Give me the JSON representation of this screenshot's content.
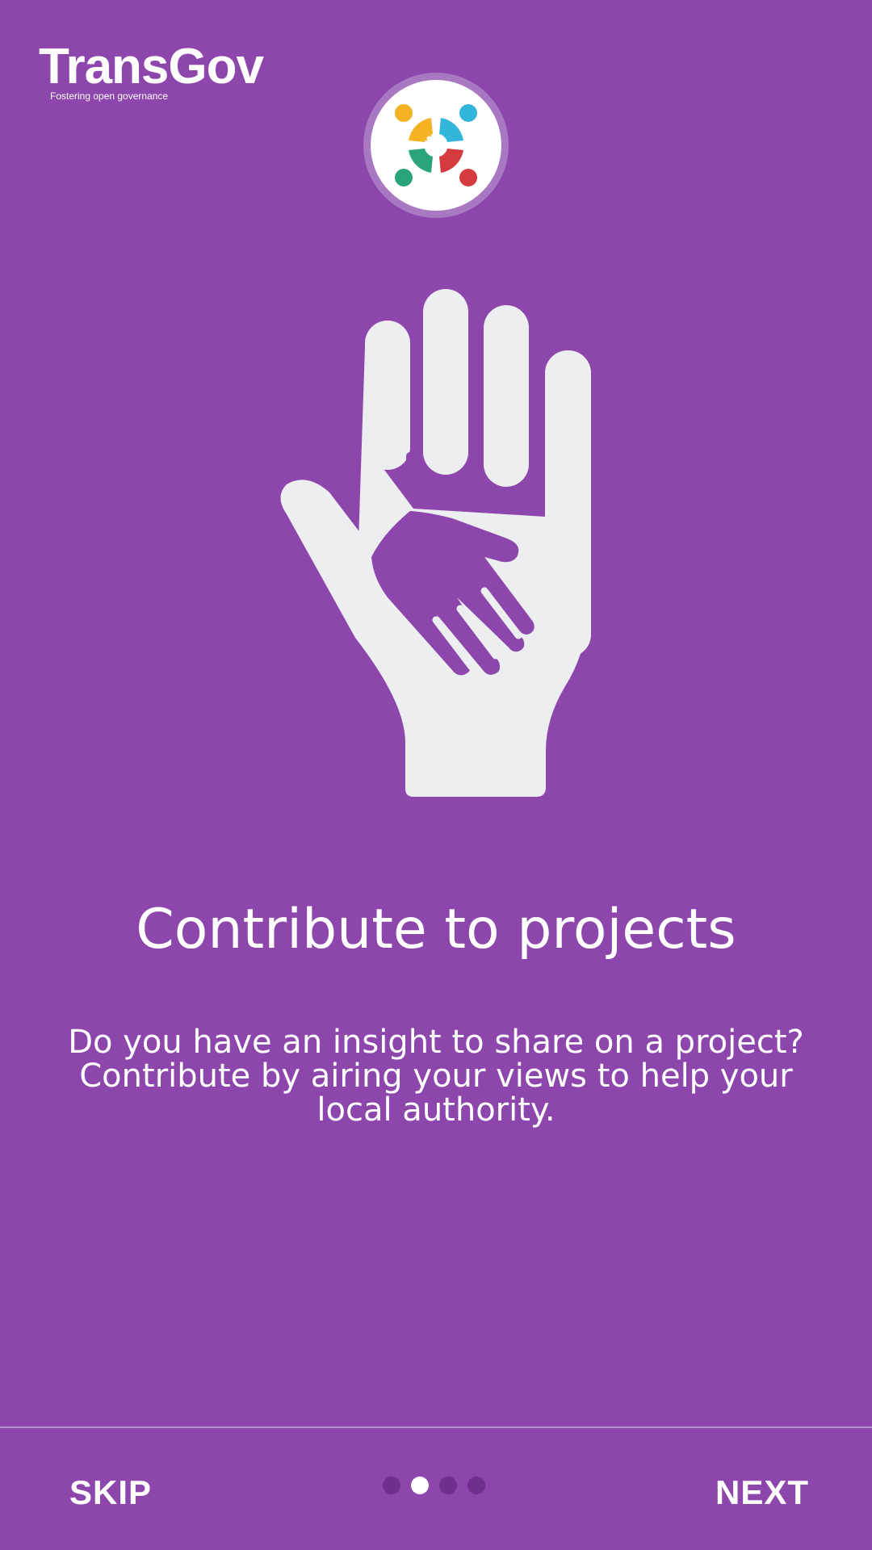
{
  "brand": {
    "name": "TransGov",
    "tagline": "Fostering open governance"
  },
  "onboarding": {
    "title": "Contribute to projects",
    "description": "Do you have an insight to share on a project? Contribute by airing your views to help your local authority.",
    "illustration": "helping-hands-icon",
    "logo": "people-circle-logo"
  },
  "pager": {
    "total_pages": 4,
    "current_page": 2
  },
  "footer": {
    "skip_label": "SKIP",
    "next_label": "NEXT"
  },
  "colors": {
    "background": "#8d46ab",
    "hand": "#eceef0",
    "dot_inactive": "#6f2f8c",
    "dot_active": "#ffffff",
    "logo_yellow": "#f5b324",
    "logo_blue": "#34b5dc",
    "logo_green": "#2aa57a",
    "logo_red": "#d53a3f"
  }
}
